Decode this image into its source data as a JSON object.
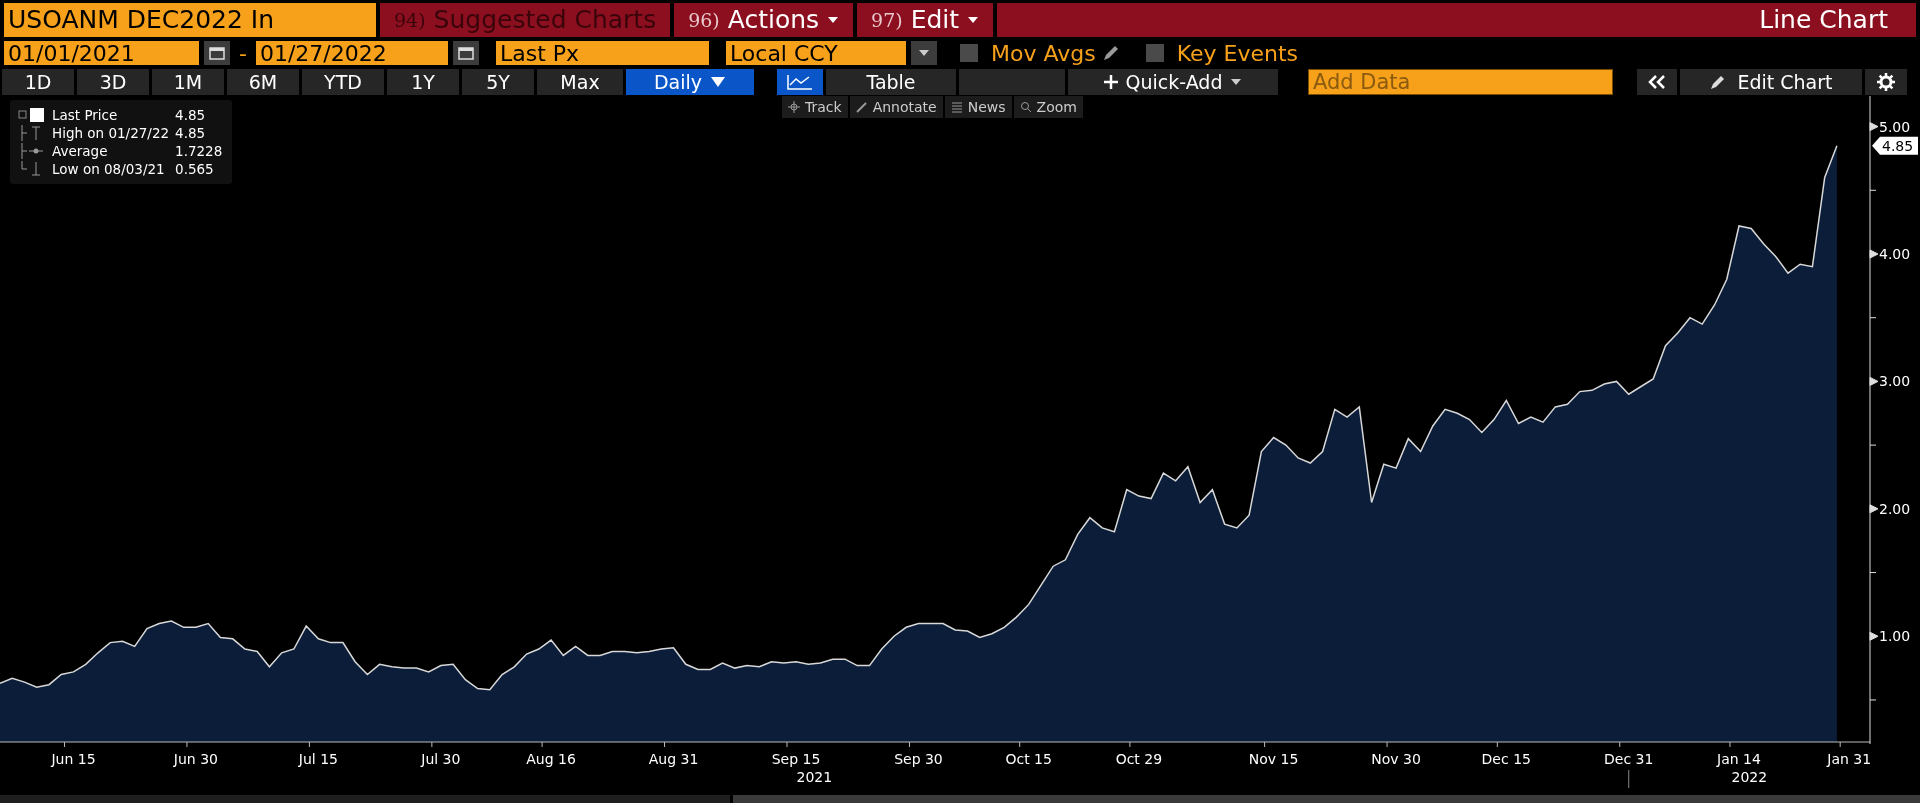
{
  "header": {
    "security": "USOANM DEC2022 In",
    "menus": [
      {
        "number": "94)",
        "label": "Suggested Charts",
        "disabled": true,
        "dropdown": false
      },
      {
        "number": "96)",
        "label": "Actions",
        "disabled": false,
        "dropdown": true
      },
      {
        "number": "97)",
        "label": "Edit",
        "disabled": false,
        "dropdown": true
      }
    ],
    "title": "Line Chart"
  },
  "controls": {
    "start_date": "01/01/2021",
    "separator": "-",
    "end_date": "01/27/2022",
    "field": "Last Px",
    "currency": "Local CCY",
    "options": [
      {
        "label": "Mov Avgs",
        "checked": false,
        "editable": true
      },
      {
        "label": "Key Events",
        "checked": false,
        "editable": false
      }
    ]
  },
  "periods": [
    {
      "label": "1D",
      "selected": false
    },
    {
      "label": "3D",
      "selected": false
    },
    {
      "label": "1M",
      "selected": false
    },
    {
      "label": "6M",
      "selected": false
    },
    {
      "label": "YTD",
      "selected": false
    },
    {
      "label": "1Y",
      "selected": false
    },
    {
      "label": "5Y",
      "selected": false
    },
    {
      "label": "Max",
      "selected": false
    }
  ],
  "frequency": {
    "label": "Daily",
    "selected": true
  },
  "views": [
    {
      "kind": "icon",
      "selected": true
    },
    {
      "kind": "text",
      "label": "Table",
      "selected": false
    }
  ],
  "quick_add": "Quick-Add",
  "add_data": {
    "placeholder": "Add Data"
  },
  "edit_chart": "Edit Chart",
  "chart_tools": [
    {
      "kind": "track",
      "label": "Track"
    },
    {
      "kind": "annotate",
      "label": "Annotate"
    },
    {
      "kind": "news",
      "label": "News"
    },
    {
      "kind": "zoom",
      "label": "Zoom"
    }
  ],
  "legend": [
    {
      "kind": "series",
      "value": "4.85"
    },
    {
      "kind": "high",
      "label": "High on 01/27/22",
      "value": "4.85"
    },
    {
      "kind": "average",
      "label": "Average",
      "value": "1.7228"
    },
    {
      "kind": "low",
      "label": "Low on 08/03/21",
      "value": "0.565"
    }
  ],
  "chart": {
    "last_value_label": "4.85",
    "years": [
      {
        "label": "2021"
      },
      {
        "label": "2022"
      }
    ],
    "chart_data": {
      "type": "area",
      "ylim": [
        0.17,
        5.24
      ],
      "categories": [
        null,
        null,
        null,
        null,
        null,
        null,
        "Jun 15",
        null,
        null,
        null,
        null,
        null,
        null,
        null,
        null,
        null,
        "Jun 30",
        null,
        null,
        null,
        null,
        null,
        null,
        null,
        null,
        null,
        "Jul 15",
        null,
        null,
        null,
        null,
        null,
        null,
        null,
        null,
        null,
        "Jul 30",
        null,
        null,
        null,
        null,
        null,
        null,
        null,
        null,
        "Aug 16",
        null,
        null,
        null,
        null,
        null,
        null,
        null,
        null,
        null,
        "Aug 31",
        null,
        null,
        null,
        null,
        null,
        null,
        null,
        null,
        null,
        "Sep 15",
        null,
        null,
        null,
        null,
        null,
        null,
        null,
        null,
        null,
        "Sep 30",
        null,
        null,
        null,
        null,
        null,
        null,
        null,
        null,
        "Oct 15",
        null,
        null,
        null,
        null,
        null,
        null,
        null,
        null,
        "Oct 29",
        null,
        null,
        null,
        null,
        null,
        null,
        null,
        null,
        null,
        null,
        "Nov 15",
        null,
        null,
        null,
        null,
        null,
        null,
        null,
        null,
        null,
        "Nov 30",
        null,
        null,
        null,
        null,
        null,
        null,
        null,
        null,
        "Dec 15",
        null,
        null,
        null,
        null,
        null,
        null,
        null,
        null,
        null,
        "Dec 31",
        null,
        null,
        null,
        null,
        null,
        null,
        null,
        null,
        "Jan 14",
        null,
        null,
        null,
        null,
        null,
        null,
        null,
        null,
        "Jan 31",
        null
      ],
      "yticks": [
        {
          "value": 1,
          "label": "1.00"
        },
        {
          "value": 2,
          "label": "2.00"
        },
        {
          "value": 3,
          "label": "3.00"
        },
        {
          "value": 4,
          "label": "4.00"
        },
        {
          "value": 5,
          "label": "5.00"
        }
      ],
      "series": [
        {
          "name": "Last Price",
          "color": "#d8d8d8",
          "values": [
            0.63,
            0.67,
            0.64,
            0.6,
            0.62,
            0.7,
            0.72,
            0.78,
            0.87,
            0.95,
            0.96,
            0.92,
            1.06,
            1.1,
            1.12,
            1.07,
            1.07,
            1.1,
            0.99,
            0.98,
            0.9,
            0.88,
            0.76,
            0.87,
            0.9,
            1.08,
            0.98,
            0.95,
            0.95,
            0.8,
            0.7,
            0.78,
            0.76,
            0.75,
            0.75,
            0.72,
            0.77,
            0.78,
            0.66,
            0.59,
            0.58,
            0.7,
            0.76,
            0.86,
            0.9,
            0.97,
            0.85,
            0.92,
            0.85,
            0.85,
            0.88,
            0.88,
            0.87,
            0.88,
            0.9,
            0.91,
            0.78,
            0.74,
            0.74,
            0.79,
            0.75,
            0.77,
            0.76,
            0.8,
            0.79,
            0.8,
            0.78,
            0.79,
            0.82,
            0.82,
            0.77,
            0.77,
            0.9,
            1.0,
            1.07,
            1.1,
            1.1,
            1.1,
            1.05,
            1.04,
            0.99,
            1.02,
            1.07,
            1.15,
            1.25,
            1.4,
            1.55,
            1.6,
            1.8,
            1.93,
            1.85,
            1.82,
            2.15,
            2.1,
            2.08,
            2.28,
            2.22,
            2.33,
            2.05,
            2.15,
            1.88,
            1.85,
            1.95,
            2.45,
            2.56,
            2.5,
            2.4,
            2.36,
            2.45,
            2.78,
            2.72,
            2.8,
            2.05,
            2.35,
            2.32,
            2.55,
            2.45,
            2.65,
            2.78,
            2.75,
            2.7,
            2.6,
            2.7,
            2.85,
            2.67,
            2.72,
            2.68,
            2.8,
            2.82,
            2.92,
            2.93,
            2.98,
            3.0,
            2.9,
            2.96,
            3.02,
            3.28,
            3.38,
            3.5,
            3.45,
            3.6,
            3.8,
            4.22,
            4.2,
            4.08,
            3.98,
            3.85,
            3.92,
            3.9,
            4.6,
            4.85,
            null,
            null
          ]
        }
      ]
    }
  }
}
